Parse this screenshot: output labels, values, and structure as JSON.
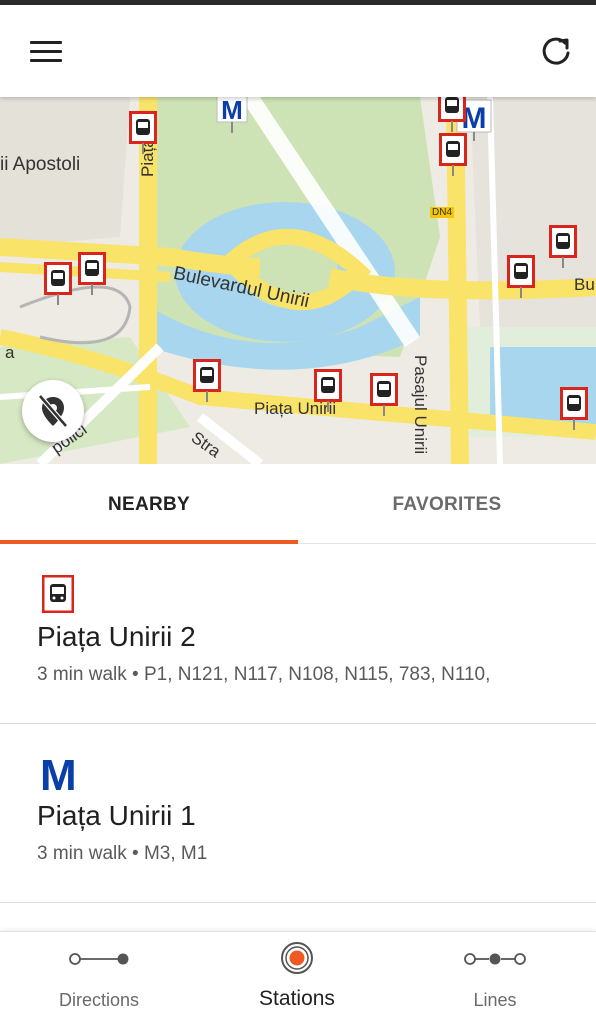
{
  "app": {
    "menu_icon": "hamburger-menu-icon",
    "refresh_icon": "refresh-icon"
  },
  "map": {
    "labels": {
      "apostoli": "ii Apostoli",
      "piata_vertical": "Piața",
      "bulevardul": "Bulevardul Unirii",
      "pasajul": "Pasajul Unirii",
      "piata_unirii": "Piața Unirii",
      "dn4": "DN4",
      "bu": "Bu",
      "polici": "polici",
      "stra": "Stra",
      "sa": "a"
    },
    "metro_letter": "M",
    "colors": {
      "road": "#f9e368",
      "water": "#a7d6ee",
      "park": "#cde3b5",
      "land": "#eeebe4",
      "pin_red": "#d9261c",
      "metro_blue": "#0a3ea8"
    }
  },
  "tabs": {
    "nearby": "NEARBY",
    "favorites": "FAVORITES",
    "active": "nearby"
  },
  "stations": [
    {
      "name": "Piața Unirii 2",
      "info": "3 min walk • P1, N121, N117, N108, N115, 783, N110,",
      "type": "bus"
    },
    {
      "name": "Piața Unirii 1",
      "info": "3 min walk • M3, M1",
      "type": "metro",
      "icon_letter": "M"
    }
  ],
  "bottom_nav": {
    "directions": "Directions",
    "stations": "Stations",
    "lines": "Lines",
    "active": "stations",
    "accent": "#ef5a24"
  }
}
